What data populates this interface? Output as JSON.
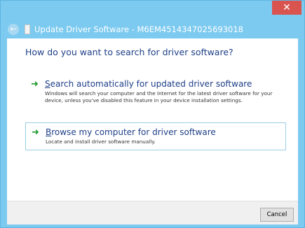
{
  "window": {
    "title": "Update Driver Software - M6EM4514347025693018",
    "close_glyph": "✕"
  },
  "nav": {
    "back_glyph": "←",
    "back_icon": "back-arrow-icon",
    "device_icon": "device-icon"
  },
  "main": {
    "question": "How do you want to search for driver software?",
    "options": [
      {
        "arrow_glyph": "➜",
        "title_underlined": "S",
        "title_rest": "earch automatically for updated driver software",
        "description": "Windows will search your computer and the Internet for the latest driver software for your device, unless you've disabled this feature in your device installation settings."
      },
      {
        "arrow_glyph": "➜",
        "title_underlined": "B",
        "title_rest": "rowse my computer for driver software",
        "description": "Locate and install driver software manually."
      }
    ]
  },
  "footer": {
    "cancel_label": "Cancel"
  },
  "colors": {
    "title_bar": "#7ccaf0",
    "close_button": "#d9534f",
    "heading_text": "#1e3f87",
    "arrow": "#1e9a2b",
    "option_border": "#9ccfe5"
  }
}
